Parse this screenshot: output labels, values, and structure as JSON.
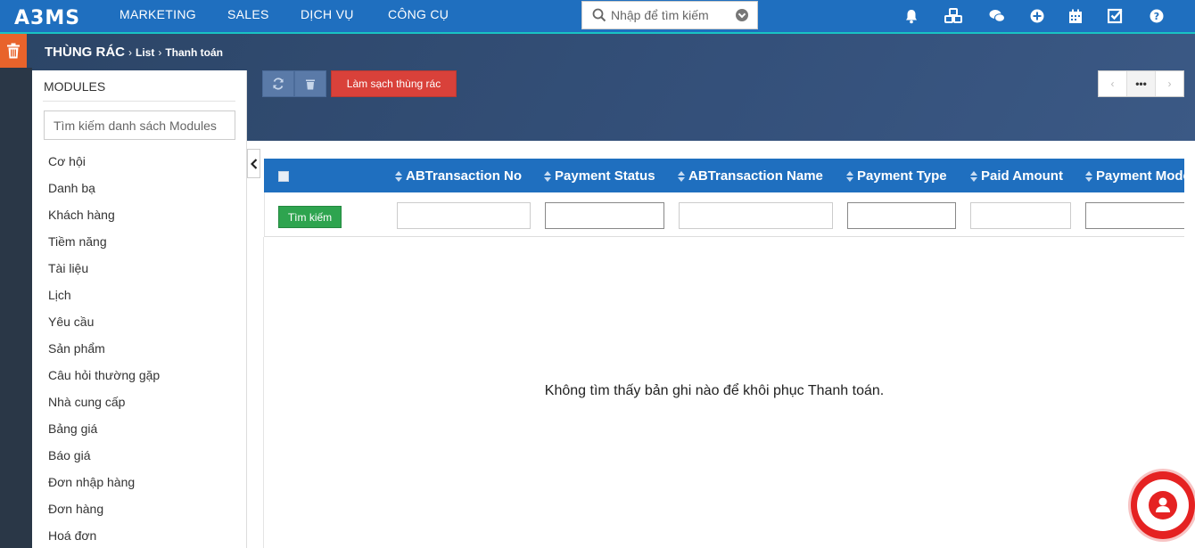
{
  "brand": {
    "logo_text": "ABMS"
  },
  "nav": {
    "items": [
      "MARKETING",
      "SALES",
      "DỊCH VỤ",
      "CÔNG CỤ"
    ],
    "search_placeholder": "Nhập để tìm kiếm"
  },
  "top_icons": [
    "bell-icon",
    "cubes-icon",
    "chat-icon",
    "plus-circle-icon",
    "calendar-icon",
    "checkbox-icon",
    "help-icon"
  ],
  "breadcrumb": {
    "section": "THÙNG RÁC",
    "level2": "List",
    "level3": "Thanh toán"
  },
  "toolbar": {
    "clean_label": "Làm sạch thùng rác",
    "pager_more": "•••"
  },
  "sidebar": {
    "title": "MODULES",
    "search_placeholder": "Tìm kiếm danh sách Modules",
    "items": [
      "Cơ hội",
      "Danh bạ",
      "Khách hàng",
      "Tiềm năng",
      "Tài liệu",
      "Lịch",
      "Yêu cầu",
      "Sản phẩm",
      "Câu hỏi thường gặp",
      "Nhà cung cấp",
      "Bảng giá",
      "Báo giá",
      "Đơn nhập hàng",
      "Đơn hàng",
      "Hoá đơn"
    ]
  },
  "table": {
    "columns": [
      "ABTransaction No",
      "Payment Status",
      "ABTransaction Name",
      "Payment Type",
      "Paid Amount",
      "Payment Mode"
    ],
    "search_button": "Tìm kiếm",
    "empty_message": "Không tìm thấy bản ghi nào để khôi phục Thanh toán."
  },
  "colors": {
    "nav_blue": "#1f6fbf",
    "accent_orange": "#e8632b",
    "danger_red": "#d9413a",
    "success_green": "#2ea44f"
  }
}
